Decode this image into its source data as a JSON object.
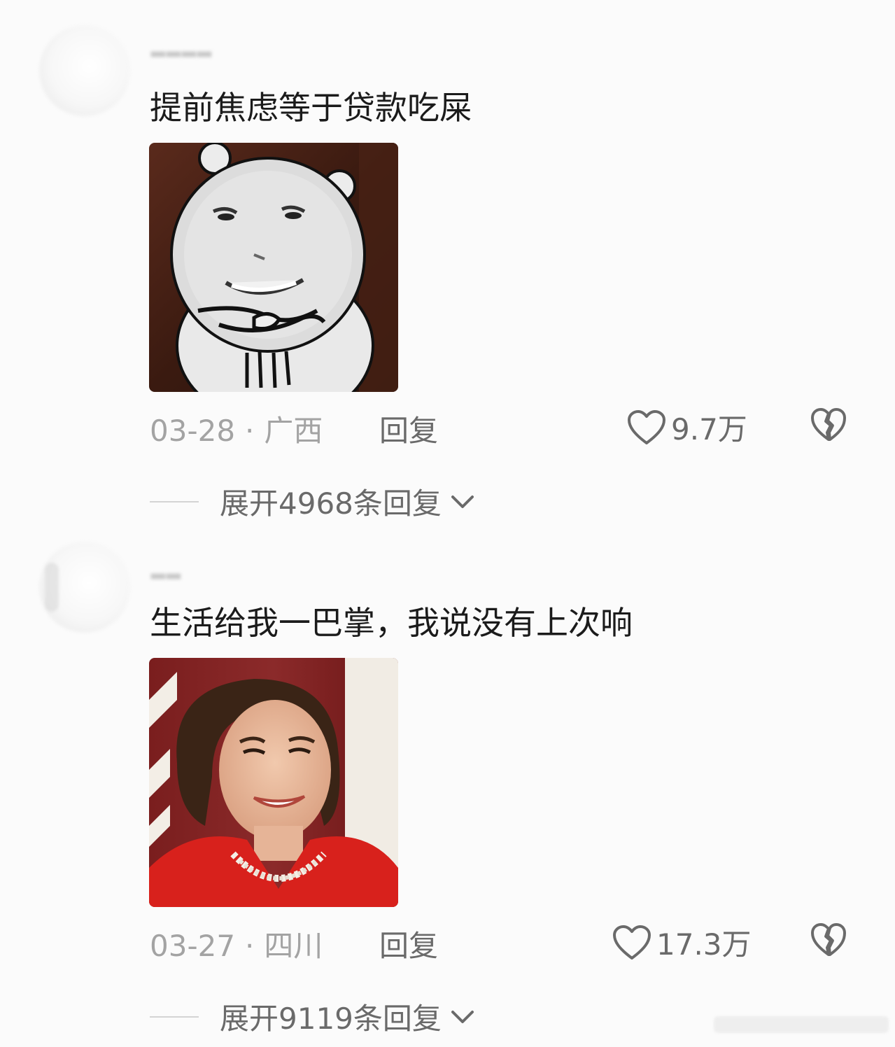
{
  "comments": [
    {
      "text": "提前焦虑等于贷款吃屎",
      "date": "03-28",
      "location": "广西",
      "reply_label": "回复",
      "likes": "9.7万",
      "expand_label": "展开4968条回复"
    },
    {
      "text": "生活给我一巴掌，我说没有上次响",
      "date": "03-27",
      "location": "四川",
      "reply_label": "回复",
      "likes": "17.3万",
      "expand_label": "展开9119条回复"
    }
  ],
  "icons": {
    "like": "heart-outline-icon",
    "dislike": "broken-heart-icon",
    "expand": "chevron-down-icon"
  },
  "colors": {
    "background": "#fbfbfb",
    "text_primary": "#1b1b1b",
    "text_meta": "#a3a3a3",
    "text_action": "#6a6a6a"
  }
}
